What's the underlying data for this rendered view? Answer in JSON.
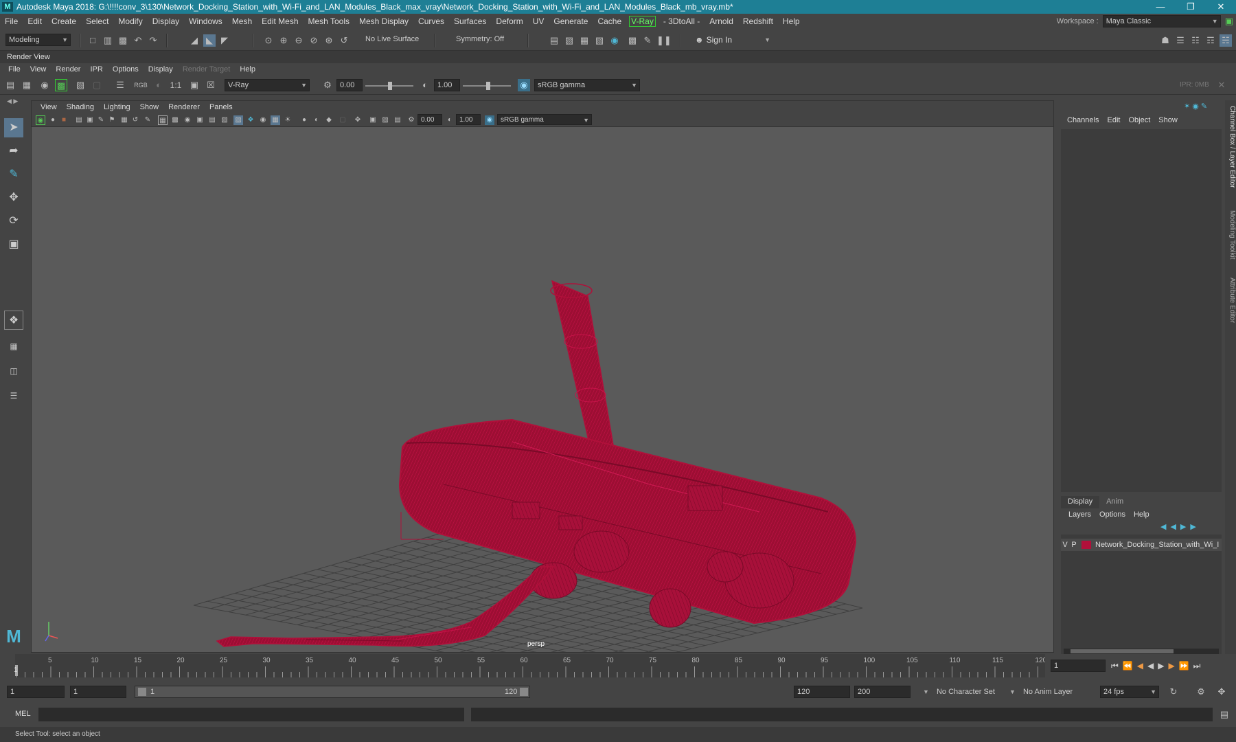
{
  "titlebar": {
    "title": "Autodesk Maya 2018: G:\\!!!!conv_3\\130\\Network_Docking_Station_with_Wi-Fi_and_LAN_Modules_Black_max_vray\\Network_Docking_Station_with_Wi-Fi_and_LAN_Modules_Black_mb_vray.mb*",
    "minimize": "—",
    "restore": "❐",
    "close": "✕"
  },
  "menubar": {
    "items": [
      "File",
      "Edit",
      "Create",
      "Select",
      "Modify",
      "Display",
      "Windows",
      "Mesh",
      "Edit Mesh",
      "Mesh Tools",
      "Mesh Display",
      "Curves",
      "Surfaces",
      "Deform",
      "UV",
      "Generate",
      "Cache"
    ],
    "vray": "V-Ray",
    "items2": [
      "- 3DtoAll -",
      "Arnold",
      "Redshift",
      "Help"
    ],
    "workspace_label": "Workspace :",
    "workspace_value": "Maya Classic"
  },
  "shelf": {
    "mode": "Modeling",
    "live_surface": "No Live Surface",
    "symmetry": "Symmetry: Off",
    "sign_in": "Sign In"
  },
  "renderview": {
    "title": "Render View",
    "menu": [
      "File",
      "View",
      "Render",
      "IPR",
      "Options",
      "Display"
    ],
    "menu_disabled": "Render Target",
    "menu_help": "Help",
    "rgb": "RGB",
    "ratio": "1:1",
    "renderer": "V-Ray",
    "exposure": "0.00",
    "gamma": "1.00",
    "colorspace": "sRGB gamma",
    "ipr": "IPR: 0MB"
  },
  "viewport": {
    "menu": [
      "View",
      "Shading",
      "Lighting",
      "Show",
      "Renderer",
      "Panels"
    ],
    "exposure": "0.00",
    "gamma": "1.00",
    "colorspace": "sRGB gamma",
    "camera": "persp"
  },
  "channelbox": {
    "menu": [
      "Channels",
      "Edit",
      "Object",
      "Show"
    ],
    "tabs": [
      "Display",
      "Anim"
    ],
    "layer_menu": [
      "Layers",
      "Options",
      "Help"
    ],
    "layer_v": "V",
    "layer_p": "P",
    "layer_color": "#b0103a",
    "layer_name": "Network_Docking_Station_with_Wi_I"
  },
  "sidetabs": [
    "Channel Box / Layer Editor",
    "Modeling Toolkit",
    "Attribute Editor"
  ],
  "timeline": {
    "ticks": [
      "5",
      "10",
      "15",
      "20",
      "25",
      "30",
      "35",
      "40",
      "45",
      "50",
      "55",
      "60",
      "65",
      "70",
      "75",
      "80",
      "85",
      "90",
      "95",
      "100",
      "105",
      "110",
      "115",
      "120"
    ],
    "start_label": "1",
    "current_frame": "1"
  },
  "range": {
    "start": "1",
    "playback_start": "1",
    "slider_start": "1",
    "slider_end": "120",
    "playback_end": "120",
    "end": "200",
    "character_set": "No Character Set",
    "anim_layer": "No Anim Layer",
    "fps": "24 fps"
  },
  "cmdline": {
    "label": "MEL"
  },
  "help": {
    "text": "Select Tool: select an object"
  },
  "colors": {
    "wire": "#b0103a",
    "titlebar": "#1e7f95",
    "viewport_bg": "#5a5a5a",
    "accent": "#4fb8d6"
  }
}
